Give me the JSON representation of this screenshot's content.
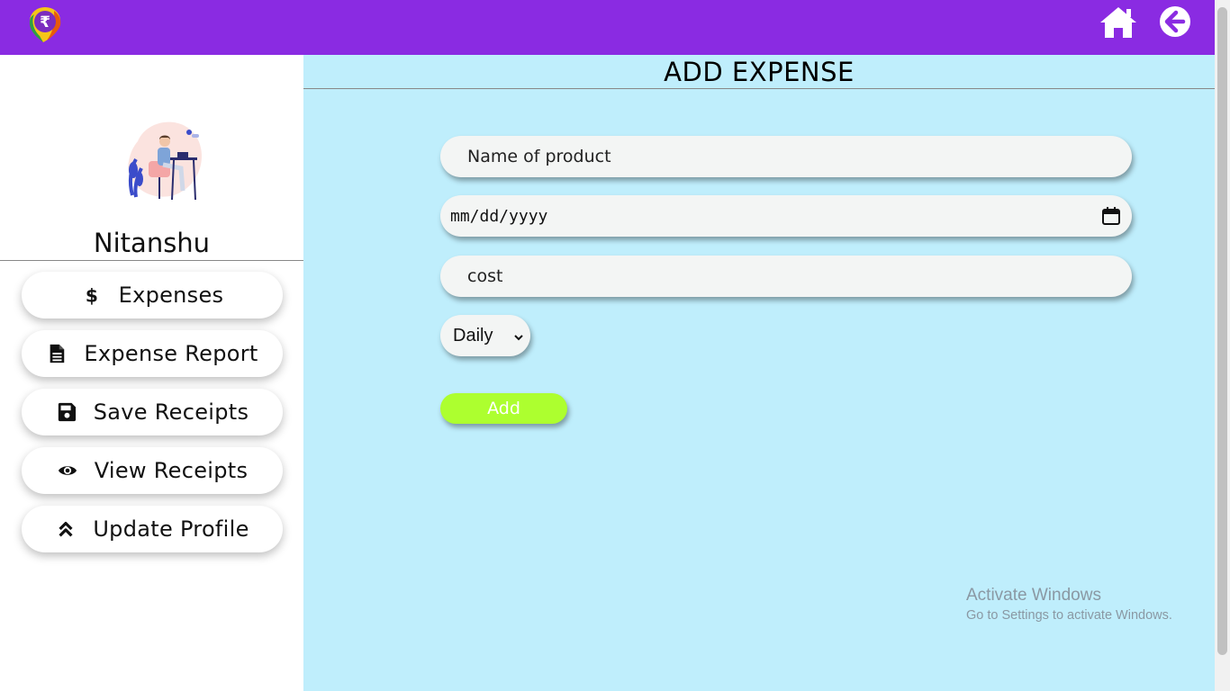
{
  "colors": {
    "topbar": "#8a2be2",
    "main_bg": "#bfeefc",
    "add_button": "#adff2f",
    "field_bg": "#f3f5f4"
  },
  "header": {
    "logo_icon": "rupee-logo-icon",
    "home_icon": "home-icon",
    "back_icon": "arrow-left-circle-icon"
  },
  "sidebar": {
    "avatar_icon": "user-at-desk-illustration",
    "username": "Nitanshu",
    "items": [
      {
        "label": "Expenses",
        "icon": "dollar-icon"
      },
      {
        "label": "Expense Report",
        "icon": "file-text-icon"
      },
      {
        "label": "Save Receipts",
        "icon": "floppy-disk-icon"
      },
      {
        "label": "View Receipts",
        "icon": "eye-icon"
      },
      {
        "label": "Update Profile",
        "icon": "double-chevron-up-icon"
      }
    ]
  },
  "main": {
    "title": "ADD EXPENSE",
    "form": {
      "product_placeholder": "Name of product",
      "date_placeholder": "mm/dd/yyyy",
      "cost_placeholder": "cost",
      "frequency_selected": "Daily",
      "add_label": "Add"
    }
  },
  "watermark": {
    "title": "Activate Windows",
    "subtitle": "Go to Settings to activate Windows."
  }
}
